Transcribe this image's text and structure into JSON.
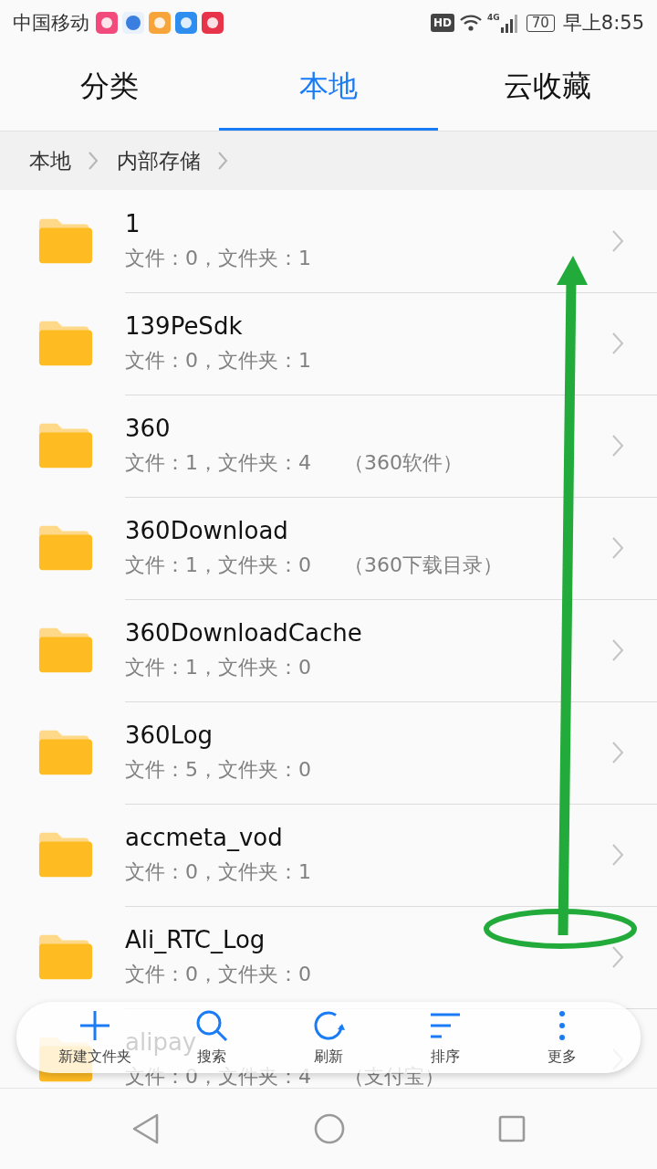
{
  "status_bar": {
    "carrier": "中国移动",
    "hd": "HD",
    "network": "4G",
    "battery": "70",
    "time": "早上8:55"
  },
  "tabs": [
    {
      "label": "分类",
      "selected": false
    },
    {
      "label": "本地",
      "selected": true
    },
    {
      "label": "云收藏",
      "selected": false
    }
  ],
  "breadcrumb": [
    "本地",
    "内部存储"
  ],
  "folders": [
    {
      "name": "1",
      "meta": "文件：0，文件夹：1"
    },
    {
      "name": "139PeSdk",
      "meta": "文件：0，文件夹：1"
    },
    {
      "name": "360",
      "meta": "文件：1，文件夹：4",
      "note": "（360软件）"
    },
    {
      "name": "360Download",
      "meta": "文件：1，文件夹：0",
      "note": "（360下载目录）"
    },
    {
      "name": "360DownloadCache",
      "meta": "文件：1，文件夹：0"
    },
    {
      "name": "360Log",
      "meta": "文件：5，文件夹：0"
    },
    {
      "name": "accmeta_vod",
      "meta": "文件：0，文件夹：1"
    },
    {
      "name": "Ali_RTC_Log",
      "meta": "文件：0，文件夹：0"
    },
    {
      "name": "alipay",
      "meta": "文件：0，文件夹：4",
      "note": "（支付宝）"
    }
  ],
  "toolbar": [
    {
      "kind": "add",
      "label": "新建文件夹"
    },
    {
      "kind": "search",
      "label": "搜索"
    },
    {
      "kind": "refresh",
      "label": "刷新"
    },
    {
      "kind": "sort",
      "label": "排序"
    },
    {
      "kind": "more",
      "label": "更多"
    }
  ]
}
